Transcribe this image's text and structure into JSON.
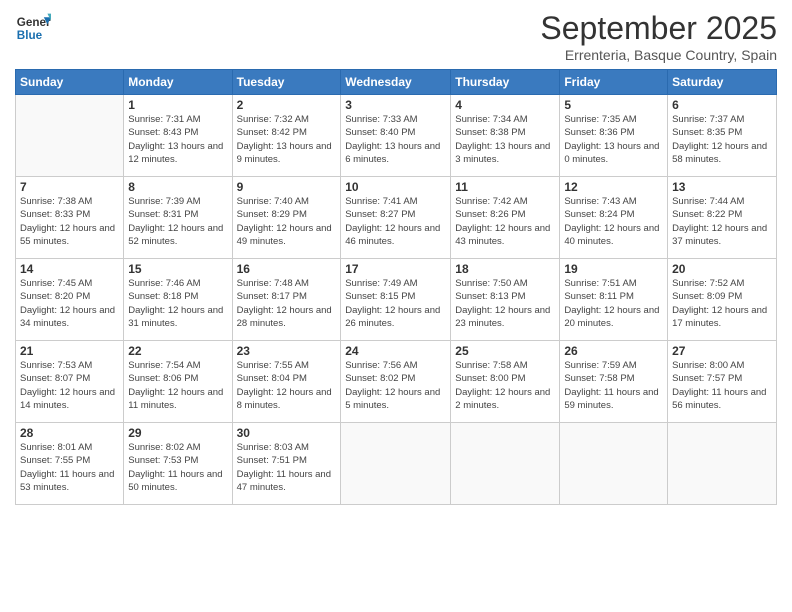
{
  "header": {
    "logo_line1": "General",
    "logo_line2": "Blue",
    "month": "September 2025",
    "location": "Errenteria, Basque Country, Spain"
  },
  "days_of_week": [
    "Sunday",
    "Monday",
    "Tuesday",
    "Wednesday",
    "Thursday",
    "Friday",
    "Saturday"
  ],
  "weeks": [
    [
      {
        "day": "",
        "sunrise": "",
        "sunset": "",
        "daylight": ""
      },
      {
        "day": "1",
        "sunrise": "Sunrise: 7:31 AM",
        "sunset": "Sunset: 8:43 PM",
        "daylight": "Daylight: 13 hours and 12 minutes."
      },
      {
        "day": "2",
        "sunrise": "Sunrise: 7:32 AM",
        "sunset": "Sunset: 8:42 PM",
        "daylight": "Daylight: 13 hours and 9 minutes."
      },
      {
        "day": "3",
        "sunrise": "Sunrise: 7:33 AM",
        "sunset": "Sunset: 8:40 PM",
        "daylight": "Daylight: 13 hours and 6 minutes."
      },
      {
        "day": "4",
        "sunrise": "Sunrise: 7:34 AM",
        "sunset": "Sunset: 8:38 PM",
        "daylight": "Daylight: 13 hours and 3 minutes."
      },
      {
        "day": "5",
        "sunrise": "Sunrise: 7:35 AM",
        "sunset": "Sunset: 8:36 PM",
        "daylight": "Daylight: 13 hours and 0 minutes."
      },
      {
        "day": "6",
        "sunrise": "Sunrise: 7:37 AM",
        "sunset": "Sunset: 8:35 PM",
        "daylight": "Daylight: 12 hours and 58 minutes."
      }
    ],
    [
      {
        "day": "7",
        "sunrise": "Sunrise: 7:38 AM",
        "sunset": "Sunset: 8:33 PM",
        "daylight": "Daylight: 12 hours and 55 minutes."
      },
      {
        "day": "8",
        "sunrise": "Sunrise: 7:39 AM",
        "sunset": "Sunset: 8:31 PM",
        "daylight": "Daylight: 12 hours and 52 minutes."
      },
      {
        "day": "9",
        "sunrise": "Sunrise: 7:40 AM",
        "sunset": "Sunset: 8:29 PM",
        "daylight": "Daylight: 12 hours and 49 minutes."
      },
      {
        "day": "10",
        "sunrise": "Sunrise: 7:41 AM",
        "sunset": "Sunset: 8:27 PM",
        "daylight": "Daylight: 12 hours and 46 minutes."
      },
      {
        "day": "11",
        "sunrise": "Sunrise: 7:42 AM",
        "sunset": "Sunset: 8:26 PM",
        "daylight": "Daylight: 12 hours and 43 minutes."
      },
      {
        "day": "12",
        "sunrise": "Sunrise: 7:43 AM",
        "sunset": "Sunset: 8:24 PM",
        "daylight": "Daylight: 12 hours and 40 minutes."
      },
      {
        "day": "13",
        "sunrise": "Sunrise: 7:44 AM",
        "sunset": "Sunset: 8:22 PM",
        "daylight": "Daylight: 12 hours and 37 minutes."
      }
    ],
    [
      {
        "day": "14",
        "sunrise": "Sunrise: 7:45 AM",
        "sunset": "Sunset: 8:20 PM",
        "daylight": "Daylight: 12 hours and 34 minutes."
      },
      {
        "day": "15",
        "sunrise": "Sunrise: 7:46 AM",
        "sunset": "Sunset: 8:18 PM",
        "daylight": "Daylight: 12 hours and 31 minutes."
      },
      {
        "day": "16",
        "sunrise": "Sunrise: 7:48 AM",
        "sunset": "Sunset: 8:17 PM",
        "daylight": "Daylight: 12 hours and 28 minutes."
      },
      {
        "day": "17",
        "sunrise": "Sunrise: 7:49 AM",
        "sunset": "Sunset: 8:15 PM",
        "daylight": "Daylight: 12 hours and 26 minutes."
      },
      {
        "day": "18",
        "sunrise": "Sunrise: 7:50 AM",
        "sunset": "Sunset: 8:13 PM",
        "daylight": "Daylight: 12 hours and 23 minutes."
      },
      {
        "day": "19",
        "sunrise": "Sunrise: 7:51 AM",
        "sunset": "Sunset: 8:11 PM",
        "daylight": "Daylight: 12 hours and 20 minutes."
      },
      {
        "day": "20",
        "sunrise": "Sunrise: 7:52 AM",
        "sunset": "Sunset: 8:09 PM",
        "daylight": "Daylight: 12 hours and 17 minutes."
      }
    ],
    [
      {
        "day": "21",
        "sunrise": "Sunrise: 7:53 AM",
        "sunset": "Sunset: 8:07 PM",
        "daylight": "Daylight: 12 hours and 14 minutes."
      },
      {
        "day": "22",
        "sunrise": "Sunrise: 7:54 AM",
        "sunset": "Sunset: 8:06 PM",
        "daylight": "Daylight: 12 hours and 11 minutes."
      },
      {
        "day": "23",
        "sunrise": "Sunrise: 7:55 AM",
        "sunset": "Sunset: 8:04 PM",
        "daylight": "Daylight: 12 hours and 8 minutes."
      },
      {
        "day": "24",
        "sunrise": "Sunrise: 7:56 AM",
        "sunset": "Sunset: 8:02 PM",
        "daylight": "Daylight: 12 hours and 5 minutes."
      },
      {
        "day": "25",
        "sunrise": "Sunrise: 7:58 AM",
        "sunset": "Sunset: 8:00 PM",
        "daylight": "Daylight: 12 hours and 2 minutes."
      },
      {
        "day": "26",
        "sunrise": "Sunrise: 7:59 AM",
        "sunset": "Sunset: 7:58 PM",
        "daylight": "Daylight: 11 hours and 59 minutes."
      },
      {
        "day": "27",
        "sunrise": "Sunrise: 8:00 AM",
        "sunset": "Sunset: 7:57 PM",
        "daylight": "Daylight: 11 hours and 56 minutes."
      }
    ],
    [
      {
        "day": "28",
        "sunrise": "Sunrise: 8:01 AM",
        "sunset": "Sunset: 7:55 PM",
        "daylight": "Daylight: 11 hours and 53 minutes."
      },
      {
        "day": "29",
        "sunrise": "Sunrise: 8:02 AM",
        "sunset": "Sunset: 7:53 PM",
        "daylight": "Daylight: 11 hours and 50 minutes."
      },
      {
        "day": "30",
        "sunrise": "Sunrise: 8:03 AM",
        "sunset": "Sunset: 7:51 PM",
        "daylight": "Daylight: 11 hours and 47 minutes."
      },
      {
        "day": "",
        "sunrise": "",
        "sunset": "",
        "daylight": ""
      },
      {
        "day": "",
        "sunrise": "",
        "sunset": "",
        "daylight": ""
      },
      {
        "day": "",
        "sunrise": "",
        "sunset": "",
        "daylight": ""
      },
      {
        "day": "",
        "sunrise": "",
        "sunset": "",
        "daylight": ""
      }
    ]
  ]
}
